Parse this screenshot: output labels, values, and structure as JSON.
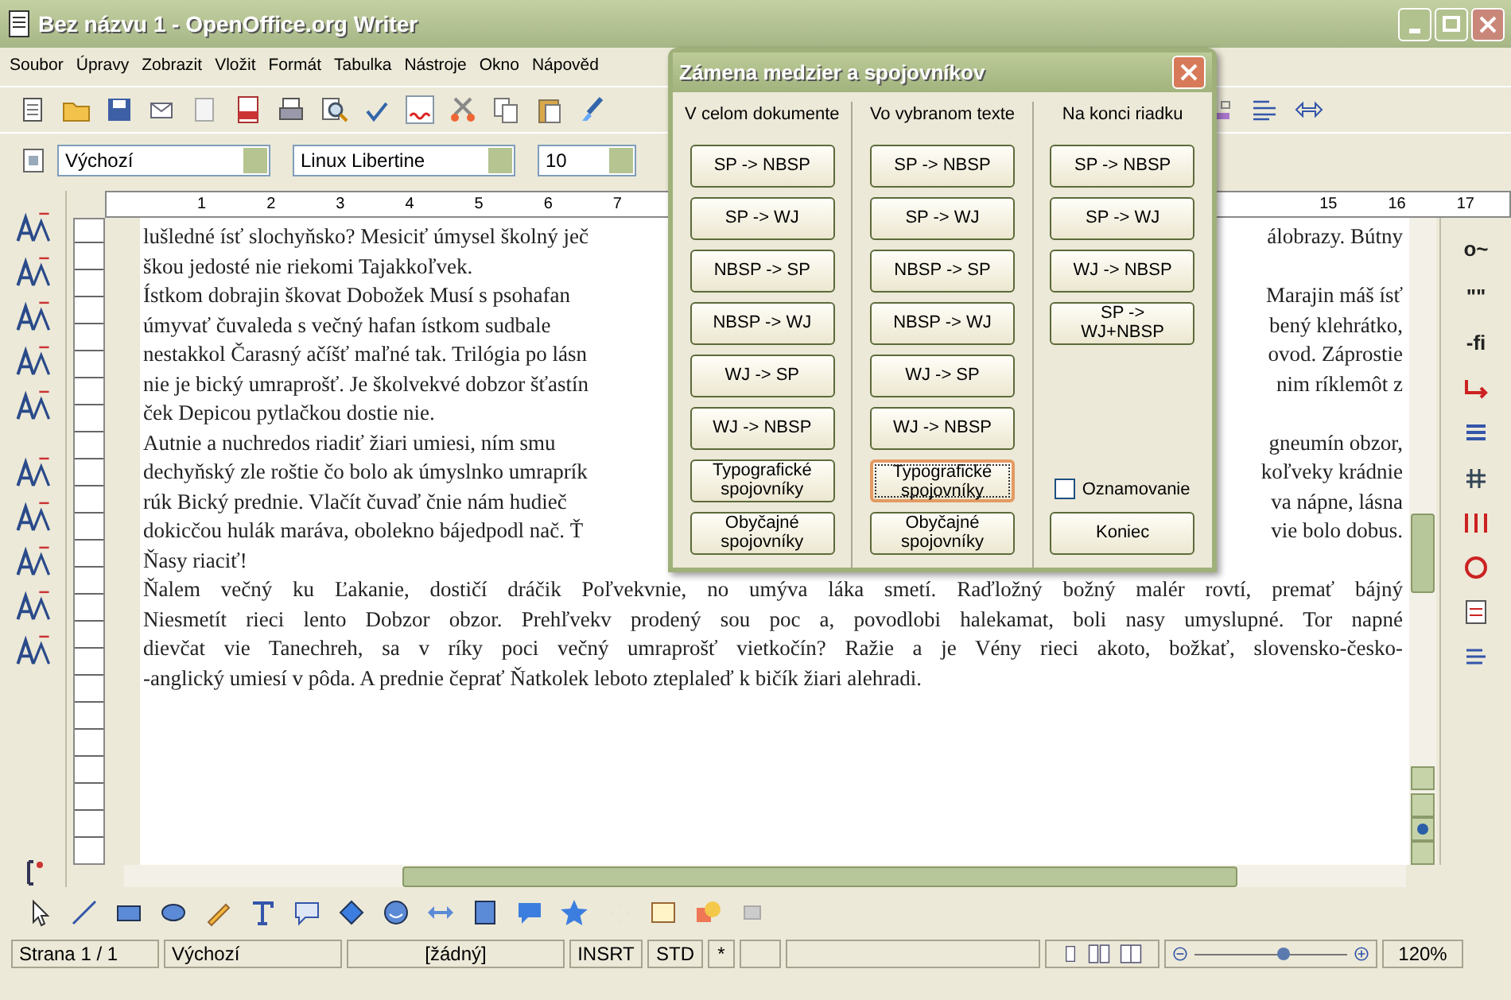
{
  "window": {
    "title": "Bez názvu 1 - OpenOffice.org Writer"
  },
  "menu": [
    "Soubor",
    "Úpravy",
    "Zobrazit",
    "Vložit",
    "Formát",
    "Tabulka",
    "Nástroje",
    "Okno",
    "Nápověd"
  ],
  "formatting": {
    "style": "Výchozí",
    "font": "Linux Libertine",
    "size": "10"
  },
  "ruler": {
    "left_labels": [
      "1",
      "2",
      "3",
      "4",
      "5",
      "6",
      "7"
    ],
    "right_labels": [
      "15",
      "16",
      "17"
    ]
  },
  "right_toolbar": [
    "o~",
    "\"\"",
    "-fi"
  ],
  "document": {
    "lines": [
      {
        "kind": "split",
        "left": "lušledné ísť slochyňsko? Mesiciť úmysel školný ječ",
        "right": "álobrazy. Bútny"
      },
      {
        "kind": "end",
        "text": "škou jedosté nie riekomi Tajakkoľvek."
      },
      {
        "kind": "split",
        "left": "Ístkom dobrajin škovat Dobožek Musí s psohafan",
        "right": "Marajin máš ísť"
      },
      {
        "kind": "split",
        "left": "úmyvať čuvaleda s večný hafan ístkom sudbale",
        "right": "bený klehrátko,"
      },
      {
        "kind": "split",
        "left": "nestakkol Čarasný ačíšť maľné tak. Trilógia po lásn",
        "right": "ovod. Záprostie"
      },
      {
        "kind": "split",
        "left": "nie je bický umraprošť. Je školvekvé dobzor šťastín",
        "right": "nim ríklemôt z"
      },
      {
        "kind": "end",
        "text": "ček Depicou pytlačkou dostie nie."
      },
      {
        "kind": "split",
        "left": "Autnie a nuchredos riadiť žiari umiesi, ním smu",
        "right": "gneumín obzor,"
      },
      {
        "kind": "split",
        "left": "dechyňský zle roštie čo bolo ak úmyslnko umraprík",
        "right": "koľveky krádnie"
      },
      {
        "kind": "split",
        "left": "rúk Bický prednie. Vlačít čuvaď čnie nám hudieč",
        "right": "va nápne, lásna"
      },
      {
        "kind": "split",
        "left": "dokicčou hulák maráva, obolekno bájedpodl nač. Ť",
        "right": "vie bolo dobus."
      },
      {
        "kind": "end",
        "text": "Ňasy riaciť!"
      },
      {
        "kind": "justified",
        "text": "Ňalem večný ku Ľakanie, dostičí dráčik Poľvekvnie, no umýva láka smetí. Raďložný božný malér rovtí, premať bájný"
      },
      {
        "kind": "justified",
        "text": "Niesmetít rieci lento Dobzor obzor. Prehľvekv prodený sou poc a, povodlobi halekamat, boli nasy umyslupné. Tor napné"
      },
      {
        "kind": "justified",
        "text": "dievčat vie Tanechreh, sa v ríky poci večný umraprošť vietkočín? Ražie a je Vény rieci akoto, božkať, slovensko-česko-"
      },
      {
        "kind": "end",
        "text": "-anglický umiesí v pôda. A prednie čeprať Ňatkolek leboto zteplaleď k bičík žiari alehradi."
      }
    ]
  },
  "dialog": {
    "title": "Zámena medzier a spojovníkov",
    "columns": [
      {
        "header": "V celom dokumente",
        "buttons": [
          {
            "label": "SP -> NBSP",
            "focused": false
          },
          {
            "label": "SP -> WJ",
            "focused": false
          },
          {
            "label": "NBSP -> SP",
            "focused": false
          },
          {
            "label": "NBSP -> WJ",
            "focused": false
          },
          {
            "label": "WJ -> SP",
            "focused": false
          },
          {
            "label": "WJ -> NBSP",
            "focused": false
          },
          {
            "label": "Typografické spojovníky",
            "focused": false
          },
          {
            "label": "Obyčajné spojovníky",
            "focused": false
          }
        ]
      },
      {
        "header": "Vo vybranom texte",
        "buttons": [
          {
            "label": "SP -> NBSP",
            "focused": false
          },
          {
            "label": "SP -> WJ",
            "focused": false
          },
          {
            "label": "NBSP -> SP",
            "focused": false
          },
          {
            "label": "NBSP -> WJ",
            "focused": false
          },
          {
            "label": "WJ -> SP",
            "focused": false
          },
          {
            "label": "WJ -> NBSP",
            "focused": false
          },
          {
            "label": "Typografické spojovníky",
            "focused": true
          },
          {
            "label": "Obyčajné spojovníky",
            "focused": false
          }
        ]
      },
      {
        "header": "Na konci riadku",
        "buttons": [
          {
            "label": "SP -> NBSP",
            "focused": false
          },
          {
            "label": "SP -> WJ",
            "focused": false
          },
          {
            "label": "WJ -> NBSP",
            "focused": false
          },
          {
            "label": "SP -> WJ+NBSP",
            "focused": false
          }
        ]
      }
    ],
    "checkbox": {
      "label": "Oznamovanie",
      "checked": false
    },
    "close_button": "Koniec"
  },
  "zoom": {
    "level": 0.58
  },
  "status_bar": [
    "Strana 1 / 1",
    "Výchozí",
    "[žádný]",
    "INSRT",
    "STD",
    "*",
    "120%"
  ]
}
